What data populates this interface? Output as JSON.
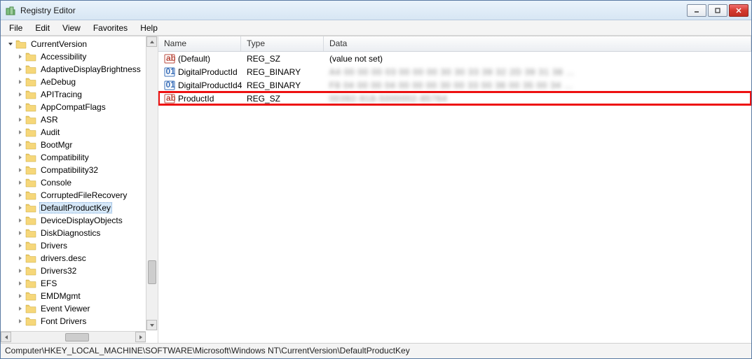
{
  "window": {
    "title": "Registry Editor"
  },
  "menu": {
    "file": "File",
    "edit": "Edit",
    "view": "View",
    "favorites": "Favorites",
    "help": "Help"
  },
  "tree": {
    "parent": {
      "label": "CurrentVersion",
      "expanded": true
    },
    "items": [
      {
        "label": "Accessibility",
        "selected": false
      },
      {
        "label": "AdaptiveDisplayBrightness",
        "selected": false
      },
      {
        "label": "AeDebug",
        "selected": false
      },
      {
        "label": "APITracing",
        "selected": false
      },
      {
        "label": "AppCompatFlags",
        "selected": false
      },
      {
        "label": "ASR",
        "selected": false
      },
      {
        "label": "Audit",
        "selected": false
      },
      {
        "label": "BootMgr",
        "selected": false
      },
      {
        "label": "Compatibility",
        "selected": false
      },
      {
        "label": "Compatibility32",
        "selected": false
      },
      {
        "label": "Console",
        "selected": false
      },
      {
        "label": "CorruptedFileRecovery",
        "selected": false
      },
      {
        "label": "DefaultProductKey",
        "selected": true
      },
      {
        "label": "DeviceDisplayObjects",
        "selected": false
      },
      {
        "label": "DiskDiagnostics",
        "selected": false
      },
      {
        "label": "Drivers",
        "selected": false
      },
      {
        "label": "drivers.desc",
        "selected": false
      },
      {
        "label": "Drivers32",
        "selected": false
      },
      {
        "label": "EFS",
        "selected": false
      },
      {
        "label": "EMDMgmt",
        "selected": false
      },
      {
        "label": "Event Viewer",
        "selected": false
      },
      {
        "label": "Font Drivers",
        "selected": false
      }
    ]
  },
  "columns": {
    "name": "Name",
    "type": "Type",
    "data": "Data"
  },
  "values": [
    {
      "icon": "string",
      "name": "(Default)",
      "type": "REG_SZ",
      "data": "(value not set)",
      "blur": false,
      "highlight": false
    },
    {
      "icon": "binary",
      "name": "DigitalProductId",
      "type": "REG_BINARY",
      "data": "A4 00 00 00 03 00 00 00 30 30 33 39 32 2D 39 31 38 …",
      "blur": true,
      "highlight": false
    },
    {
      "icon": "binary",
      "name": "DigitalProductId4",
      "type": "REG_BINARY",
      "data": "F8 04 00 00 04 00 00 00 30 00 33 00 36 00 35 00 34 …",
      "blur": true,
      "highlight": false
    },
    {
      "icon": "string",
      "name": "ProductId",
      "type": "REG_SZ",
      "data": "00392-918-5000002-85764",
      "blur": true,
      "highlight": true
    }
  ],
  "statusbar": {
    "path": "Computer\\HKEY_LOCAL_MACHINE\\SOFTWARE\\Microsoft\\Windows NT\\CurrentVersion\\DefaultProductKey"
  }
}
